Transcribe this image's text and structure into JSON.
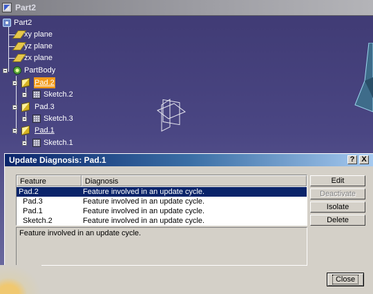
{
  "window": {
    "title": "Part2"
  },
  "tree": {
    "root": "Part2",
    "planes": [
      "xy plane",
      "yz plane",
      "zx plane"
    ],
    "body": "PartBody",
    "pads": [
      {
        "label": "Pad.2",
        "sketch": "Sketch.2"
      },
      {
        "label": "Pad.3",
        "sketch": "Sketch.3"
      },
      {
        "label": "Pad.1",
        "sketch": "Sketch.1"
      }
    ]
  },
  "dialog": {
    "title": "Update Diagnosis: Pad.1",
    "help_label": "?",
    "close_x_label": "X",
    "columns": [
      "Feature",
      "Diagnosis"
    ],
    "rows": [
      {
        "feature": "Pad.2",
        "diagnosis": "Feature involved in an update cycle.",
        "selected": true
      },
      {
        "feature": "Pad.3",
        "diagnosis": "Feature involved in an update cycle."
      },
      {
        "feature": "Pad.1",
        "diagnosis": "Feature involved in an update cycle."
      },
      {
        "feature": "Sketch.2",
        "diagnosis": "Feature involved in an update cycle."
      }
    ],
    "message": "Feature involved in an update cycle.",
    "buttons": {
      "edit": "Edit",
      "deactivate": "Deactivate",
      "isolate": "Isolate",
      "delete": "Delete",
      "close": "Close"
    }
  },
  "colors": {
    "background": "#4a4683",
    "dialog": "#d4d0c8",
    "selection": "#0a246a",
    "highlight": "#f29a1a"
  }
}
